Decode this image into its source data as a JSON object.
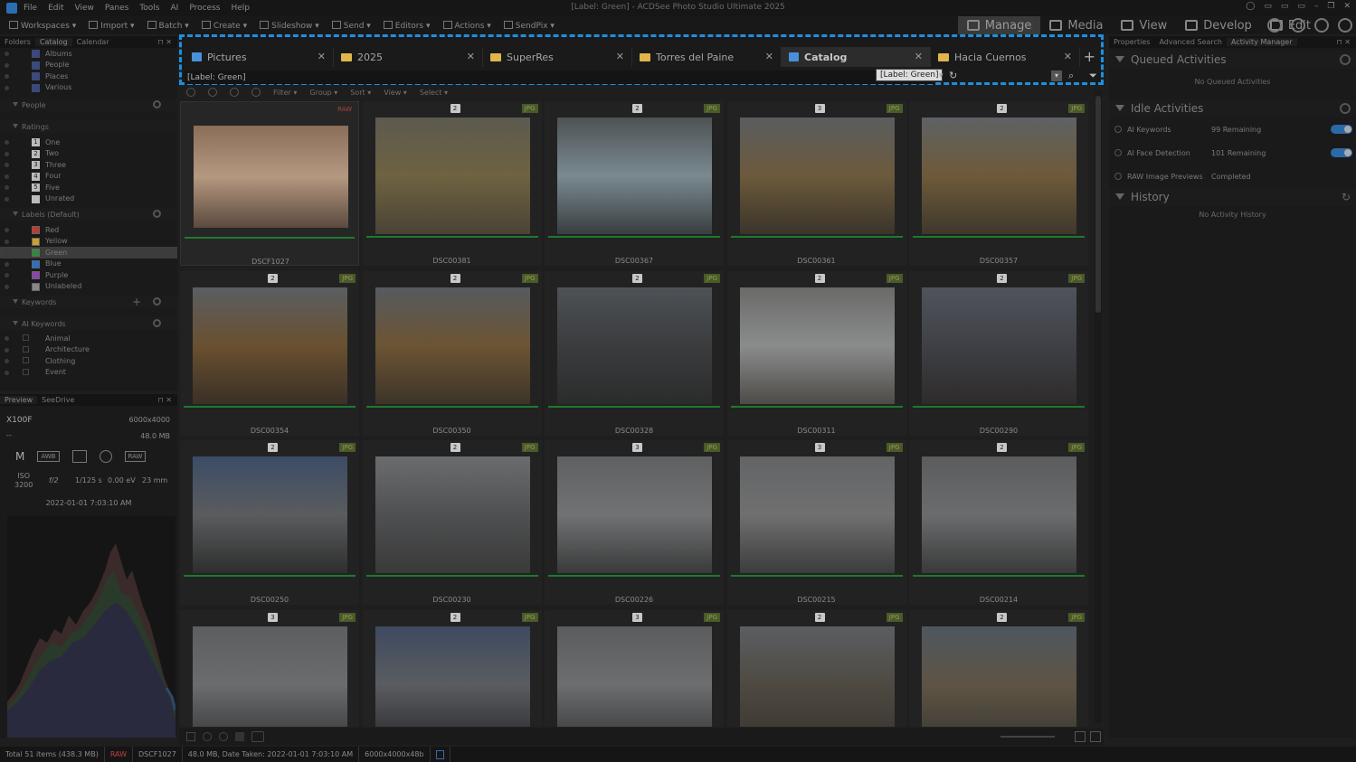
{
  "window": {
    "title": "[Label: Green] - ACDSee Photo Studio Ultimate 2025",
    "menu": [
      "File",
      "Edit",
      "View",
      "Panes",
      "Tools",
      "AI",
      "Process",
      "Help"
    ]
  },
  "toolbar": {
    "items": [
      "Workspaces",
      "Import",
      "Batch",
      "Create",
      "Slideshow",
      "Send",
      "Editors",
      "Actions",
      "SendPix"
    ],
    "modes": [
      "Manage",
      "Media",
      "View",
      "Develop",
      "Edit"
    ],
    "active_mode": "Manage"
  },
  "left_panel": {
    "tabs": [
      "Folders",
      "Catalog",
      "Calendar"
    ],
    "active_tab": "Catalog",
    "catalog_items": [
      "Albums",
      "People",
      "Places",
      "Various"
    ],
    "people_header": "People",
    "ratings_header": "Ratings",
    "ratings": [
      {
        "num": "1",
        "label": "One"
      },
      {
        "num": "2",
        "label": "Two"
      },
      {
        "num": "3",
        "label": "Three"
      },
      {
        "num": "4",
        "label": "Four"
      },
      {
        "num": "5",
        "label": "Five"
      },
      {
        "num": "",
        "label": "Unrated"
      }
    ],
    "labels_header": "Labels (Default)",
    "labels": [
      {
        "label": "Red",
        "color": "#c0392b"
      },
      {
        "label": "Yellow",
        "color": "#c9a227"
      },
      {
        "label": "Green",
        "color": "#2e8b3e"
      },
      {
        "label": "Blue",
        "color": "#2a6fc9"
      },
      {
        "label": "Purple",
        "color": "#8e44ad"
      },
      {
        "label": "Unlabeled",
        "color": "#888888"
      }
    ],
    "selected_label": "Green",
    "keywords_header": "Keywords",
    "ai_keywords_header": "AI Keywords",
    "ai_keywords": [
      "Animal",
      "Architecture",
      "Clothing",
      "Event"
    ]
  },
  "preview_panel": {
    "tabs": [
      "Preview",
      "SeeDrive"
    ],
    "camera": "X100F",
    "dimensions": "6000x4000",
    "blank": "--",
    "size": "48.0 MB",
    "mode": "M",
    "wb": "AWB",
    "iso_label": "ISO",
    "iso": "3200",
    "aperture": "f/2",
    "shutter": "1/125 s",
    "ev": "0.00 eV",
    "focal": "23 mm",
    "date": "2022-01-01 7:03:10 AM",
    "raw_badge": "RAW"
  },
  "tabs": [
    {
      "label": "Pictures",
      "icon": "pictures"
    },
    {
      "label": "2025",
      "icon": "folder"
    },
    {
      "label": "SuperRes",
      "icon": "folder"
    },
    {
      "label": "Torres del Paine",
      "icon": "folder"
    },
    {
      "label": "Catalog",
      "icon": "catalog"
    },
    {
      "label": "Hacia Cuernos",
      "icon": "folder"
    }
  ],
  "active_tab_index": 4,
  "filter": {
    "value": "[Label: Green]",
    "tooltip": "[Label: Green]"
  },
  "sub_toolbar": [
    "Filter",
    "Group",
    "Sort",
    "View",
    "Select"
  ],
  "thumbnails": [
    {
      "name": "DSCF1027",
      "count": "",
      "fmt": "RAW",
      "selected": true,
      "colors": [
        "#8a6e58",
        "#b59880",
        "#5a4a3e"
      ]
    },
    {
      "name": "DSC00381",
      "count": "2",
      "fmt": "JPG",
      "colors": [
        "#5c5a50",
        "#6e6240",
        "#4a4436"
      ]
    },
    {
      "name": "DSC00367",
      "count": "2",
      "fmt": "JPG",
      "colors": [
        "#4e5254",
        "#7a8a90",
        "#3a3e40"
      ]
    },
    {
      "name": "DSC00361",
      "count": "3",
      "fmt": "JPG",
      "colors": [
        "#5a5c5e",
        "#6c5a3c",
        "#3a342a"
      ]
    },
    {
      "name": "DSC00357",
      "count": "2",
      "fmt": "JPG",
      "colors": [
        "#5e6264",
        "#6e5a3a",
        "#3e382c"
      ]
    },
    {
      "name": "DSC00354",
      "count": "2",
      "fmt": "JPG",
      "colors": [
        "#5a5e62",
        "#6a5030",
        "#3a3026"
      ]
    },
    {
      "name": "DSC00350",
      "count": "2",
      "fmt": "JPG",
      "colors": [
        "#565a5e",
        "#6c5434",
        "#3c3428"
      ]
    },
    {
      "name": "DSC00328",
      "count": "2",
      "fmt": "JPG",
      "colors": [
        "#4e5256",
        "#3a3c3e",
        "#2a2c2c"
      ]
    },
    {
      "name": "DSC00311",
      "count": "2",
      "fmt": "JPG",
      "colors": [
        "#6a6a68",
        "#8a8c8c",
        "#4e4c48"
      ]
    },
    {
      "name": "DSC00290",
      "count": "2",
      "fmt": "JPG",
      "colors": [
        "#50545a",
        "#3e4046",
        "#2e2c2a"
      ]
    },
    {
      "name": "DSC00250",
      "count": "2",
      "fmt": "JPG",
      "colors": [
        "#3c4c66",
        "#5a5c5e",
        "#2e2e2e"
      ]
    },
    {
      "name": "DSC00230",
      "count": "2",
      "fmt": "JPG",
      "colors": [
        "#6a6c6e",
        "#4e5052",
        "#3a3a38"
      ]
    },
    {
      "name": "DSC00226",
      "count": "3",
      "fmt": "JPG",
      "colors": [
        "#5e6062",
        "#707274",
        "#3a3a3a"
      ]
    },
    {
      "name": "DSC00215",
      "count": "3",
      "fmt": "JPG",
      "colors": [
        "#626466",
        "#707070",
        "#3c3c3c"
      ]
    },
    {
      "name": "DSC00214",
      "count": "2",
      "fmt": "JPG",
      "colors": [
        "#5a5c5e",
        "#6a6c6e",
        "#3a3a3a"
      ]
    },
    {
      "name": "",
      "count": "3",
      "fmt": "JPG",
      "colors": [
        "#5c5e60",
        "#6a6c6e",
        "#3a3a3a"
      ]
    },
    {
      "name": "",
      "count": "2",
      "fmt": "JPG",
      "colors": [
        "#3e4a60",
        "#5a5c60",
        "#2e2e30"
      ]
    },
    {
      "name": "",
      "count": "3",
      "fmt": "JPG",
      "colors": [
        "#5a5c5e",
        "#6c6e70",
        "#3a3a3a"
      ]
    },
    {
      "name": "",
      "count": "2",
      "fmt": "JPG",
      "colors": [
        "#5a5e62",
        "#4e4a42",
        "#3a3630"
      ]
    },
    {
      "name": "",
      "count": "2",
      "fmt": "JPG",
      "colors": [
        "#4e5660",
        "#5e5444",
        "#3c3a34"
      ]
    }
  ],
  "right_panel": {
    "tabs": [
      "Properties",
      "Advanced Search",
      "Activity Manager"
    ],
    "active_tab": "Activity Manager",
    "queued_header": "Queued Activities",
    "queued_note": "No Queued Activities",
    "idle_header": "Idle Activities",
    "idle": [
      {
        "name": "AI Keywords",
        "value": "99 Remaining",
        "toggle": true
      },
      {
        "name": "AI Face Detection",
        "value": "101 Remaining",
        "toggle": true
      },
      {
        "name": "RAW Image Previews",
        "value": "Completed",
        "toggle": false
      }
    ],
    "history_header": "History",
    "history_note": "No Activity History"
  },
  "status": {
    "total": "Total 51 items  (438.3 MB)",
    "raw": "RAW",
    "file": "DSCF1027",
    "info": "48.0 MB, Date Taken: 2022-01-01 7:03:10 AM",
    "dims": "6000x4000x48b"
  },
  "accent": "#1e8fe0"
}
